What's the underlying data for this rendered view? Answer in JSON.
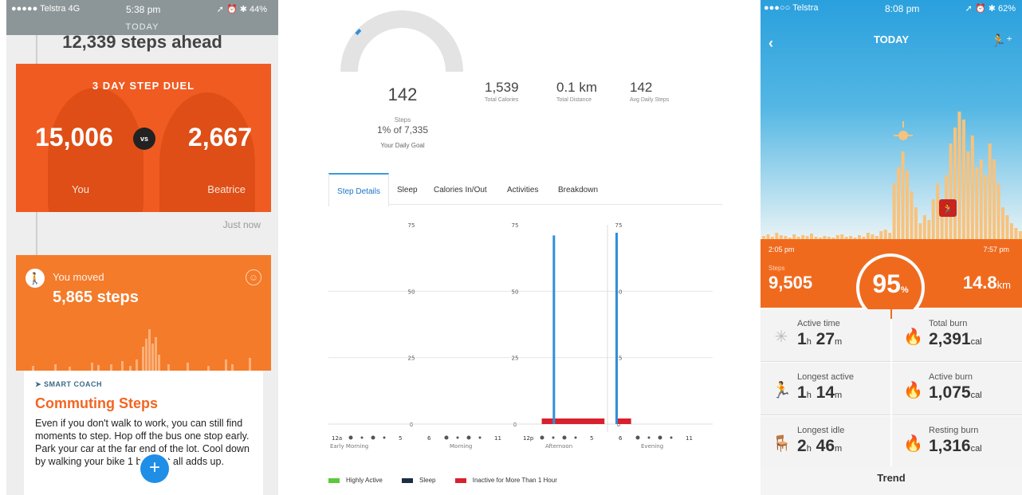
{
  "panel1": {
    "status": {
      "carrier": "●●●●● Telstra 4G",
      "time": "5:38 pm",
      "right": "➚ ⏰ ✱ 44%",
      "title": "TODAY"
    },
    "steps_ahead": "12,339 steps ahead",
    "duel": {
      "title": "3 DAY STEP DUEL",
      "left_value": "15,006",
      "vs": "vs",
      "right_value": "2,667",
      "left_name": "You",
      "right_name": "Beatrice"
    },
    "timestamp": "Just now",
    "moved": {
      "label": "You moved",
      "value": "5,865 steps"
    },
    "coach": {
      "tag": "SMART COACH",
      "title": "Commuting Steps",
      "body": "Even if you don't walk to work, you can still find moments to step. Hop off the bus one stop early. Park your car at the far end of the lot. Cool down by walking your bike 1 block. It all adds up."
    },
    "fab": "+"
  },
  "panel2": {
    "gauge": {
      "value": "142",
      "steps_label": "Steps",
      "pct": "1% of 7,335",
      "goal_label": "Your Daily Goal",
      "fraction": 0.02
    },
    "stats": [
      {
        "value": "1,539",
        "label": "Total Calories"
      },
      {
        "value": "0.1 km",
        "label": "Total Distance"
      },
      {
        "value": "142",
        "label": "Avg Daily Steps"
      }
    ],
    "tabs": [
      "Step Details",
      "Sleep",
      "Calories In/Out",
      "Activities",
      "Breakdown"
    ],
    "legend": [
      "Highly Active",
      "Sleep",
      "Inactive for More Than 1 Hour"
    ],
    "colors": {
      "highly_active": "#5cc93b",
      "sleep": "#1b2e44",
      "inactive": "#d9202e",
      "steps": "#2f8fd8"
    }
  },
  "chart_data": {
    "type": "bar",
    "title": "",
    "ylim": [
      0,
      75
    ],
    "yticks": [
      "75",
      "50",
      "25",
      "0"
    ],
    "groups": [
      {
        "label": "Early Morning",
        "ticks": [
          "12a",
          "5"
        ]
      },
      {
        "label": "Morning",
        "ticks": [
          "6",
          "11"
        ]
      },
      {
        "label": "Afternoon",
        "ticks": [
          "12p",
          "5"
        ]
      },
      {
        "label": "Evening",
        "ticks": [
          "6",
          "11"
        ]
      }
    ],
    "series": [
      {
        "name": "Steps",
        "points": [
          {
            "hour": 14,
            "value": 71
          },
          {
            "hour": 18,
            "value": 72
          }
        ]
      }
    ],
    "inactive_spans": [
      {
        "from": 13.3,
        "to": 17.3
      },
      {
        "from": 18.1,
        "to": 19.0
      }
    ]
  },
  "panel3": {
    "status": {
      "carrier": "●●●○○ Telstra",
      "time": "8:08 pm",
      "right": "➚ ⏰ ✱ 62%"
    },
    "title": "TODAY",
    "start_time": "2:05 pm",
    "end_time": "7:57 pm",
    "steps_label": "Steps",
    "steps_value": "9,505",
    "percent": "95",
    "percent_unit": "%",
    "distance": "14.8",
    "distance_unit": "km",
    "cells": [
      {
        "label": "Active time",
        "v1": "1",
        "u1": "h",
        "v2": "27",
        "u2": "m",
        "icon": "activity-icon"
      },
      {
        "label": "Total burn",
        "v1": "2,391",
        "u1": "cal",
        "icon": "flame-icon"
      },
      {
        "label": "Longest active",
        "v1": "1",
        "u1": "h",
        "v2": "14",
        "u2": "m",
        "icon": "runner-icon"
      },
      {
        "label": "Active burn",
        "v1": "1,075",
        "u1": "cal",
        "icon": "flame-icon"
      },
      {
        "label": "Longest idle",
        "v1": "2",
        "u1": "h",
        "v2": "46",
        "u2": "m",
        "icon": "chair-icon"
      },
      {
        "label": "Resting burn",
        "v1": "1,316",
        "u1": "cal",
        "icon": "flame-icon"
      }
    ],
    "trend": "Trend"
  }
}
